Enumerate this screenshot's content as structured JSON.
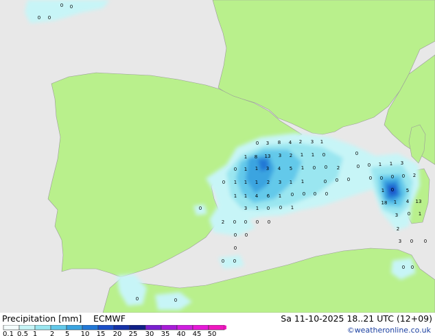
{
  "footer": {
    "title": "Precipitation [mm]",
    "model": "ECMWF",
    "datetime": "Sa 11-10-2025 18..21 UTC (12+09)",
    "credit": "©weatheronline.co.uk"
  },
  "legend": {
    "labels": [
      "0.1",
      "0.5",
      "1",
      "2",
      "5",
      "10",
      "15",
      "20",
      "25",
      "30",
      "35",
      "40",
      "45",
      "50"
    ],
    "colors": [
      "#f5fdfd",
      "#c7f5f7",
      "#9ae6f0",
      "#63c9ea",
      "#3aa4e0",
      "#2278d6",
      "#1a4fc8",
      "#1633a8",
      "#102088",
      "#7a20d0",
      "#a81cd8",
      "#d01ee0",
      "#e619d8",
      "#f018c0"
    ]
  },
  "map": {
    "land_color": "#b9f08c",
    "sea_color": "#e8e8e8",
    "precip_values": [
      "0",
      "0",
      "0",
      "0",
      "0",
      "3",
      "8",
      "4",
      "2",
      "3",
      "1",
      "1",
      "8",
      "13",
      "3",
      "2",
      "1",
      "1",
      "0",
      "0",
      "1",
      "1",
      "3",
      "4",
      "5",
      "1",
      "0",
      "0",
      "2",
      "0",
      "1",
      "1",
      "1",
      "2",
      "3",
      "1",
      "1",
      "0",
      "0",
      "0",
      "1",
      "1",
      "4",
      "6",
      "1",
      "0",
      "0",
      "0",
      "0",
      "3",
      "1",
      "0",
      "0",
      "1",
      "0",
      "2",
      "0",
      "0",
      "0",
      "0",
      "0",
      "0",
      "0",
      "0",
      "0",
      "0",
      "0",
      "0",
      "1",
      "1",
      "3",
      "0",
      "0",
      "0",
      "0",
      "2",
      "1",
      "0",
      "5",
      "18",
      "1",
      "4",
      "13",
      "3",
      "0",
      "1",
      "2",
      "3",
      "0",
      "0",
      "0",
      "0",
      "0",
      "0",
      "0",
      "0",
      "0"
    ]
  }
}
